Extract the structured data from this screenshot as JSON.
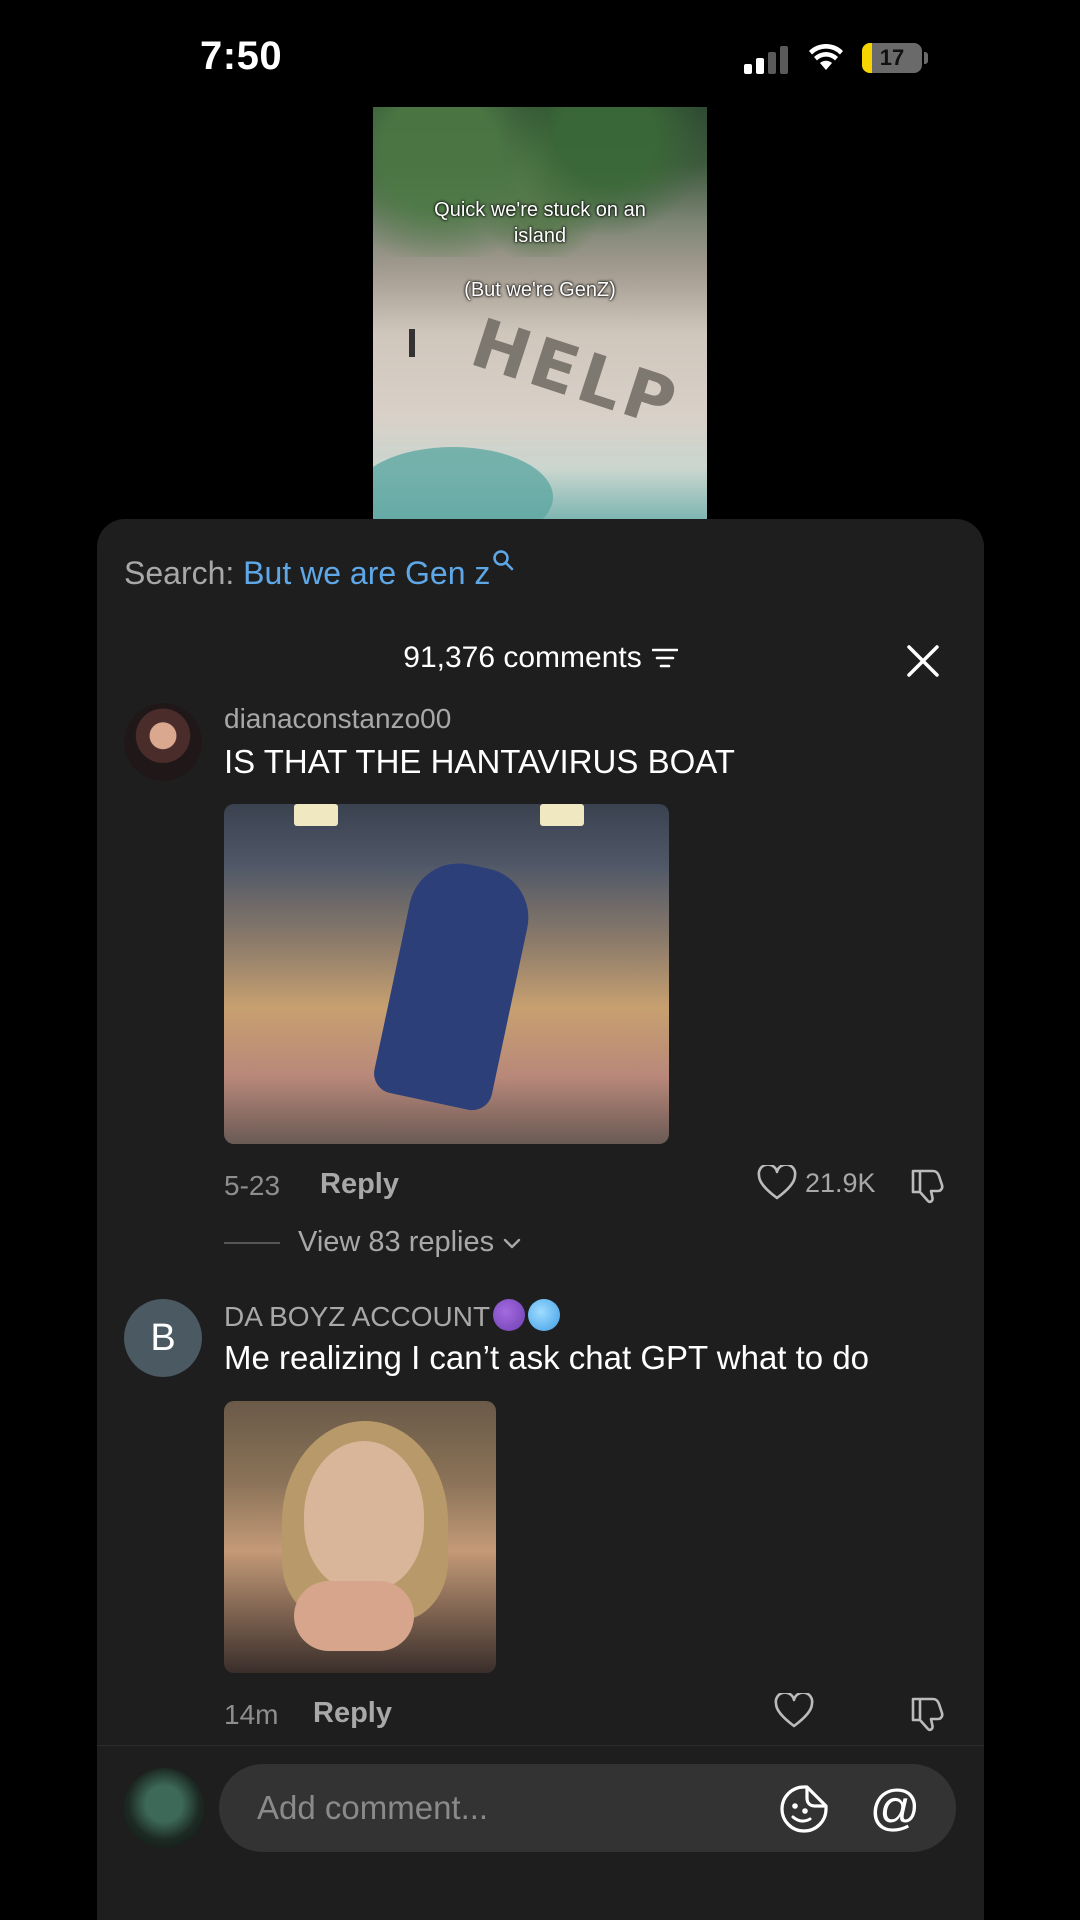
{
  "status_bar": {
    "time": "7:50",
    "battery": "17",
    "battery_level": 0.17
  },
  "video": {
    "caption_line1": "Quick we're stuck on an",
    "caption_line2": "island",
    "caption_line3": "(But we're GenZ)",
    "sand_text": "HELP"
  },
  "search": {
    "label": "Search:",
    "query": "But we are Gen z"
  },
  "comments_header": {
    "count_label": "91,376 comments"
  },
  "comments": [
    {
      "username": "dianaconstanzo00",
      "text": "IS THAT THE HANTAVIRUS BOAT",
      "date": "5-23",
      "reply_label": "Reply",
      "likes": "21.9K",
      "view_replies": "View 83 replies"
    },
    {
      "avatar_letter": "B",
      "username": "DA BOYZ ACCOUNT",
      "text": "Me realizing I can’t ask chat GPT what to do",
      "date": "14m",
      "reply_label": "Reply"
    }
  ],
  "input": {
    "placeholder": "Add comment..."
  },
  "icons": {
    "filter": "filter-icon",
    "close": "close-icon",
    "heart": "heart-icon",
    "dislike": "dislike-icon",
    "chevron": "chevron-down-icon",
    "sticker": "sticker-icon",
    "mention": "at-icon"
  },
  "colors": {
    "link_blue": "#5fa8e8",
    "panel_bg": "#1e1e1e",
    "battery_yellow": "#f5d400"
  }
}
